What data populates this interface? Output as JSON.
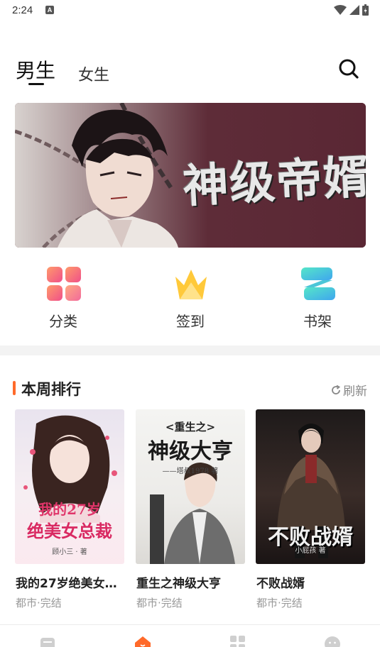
{
  "status": {
    "time": "2:24",
    "notif_glyph": "A"
  },
  "tabs": {
    "male": "男生",
    "female": "女生",
    "active": "male"
  },
  "banner": {
    "title": "神级帝婿"
  },
  "quick": [
    {
      "label": "分类",
      "icon": "category-grid-icon"
    },
    {
      "label": "签到",
      "icon": "crown-icon"
    },
    {
      "label": "书架",
      "icon": "bookshelf-icon"
    }
  ],
  "section": {
    "title": "本周排行",
    "refresh": "刷新",
    "accent": "#ff6a2a"
  },
  "books": [
    {
      "title": "我的27岁绝美女…",
      "meta": "都市·完结",
      "cover_text": "我的27岁绝美女总裁",
      "cover_line1": "我的27岁",
      "cover_line2": "绝美女总裁",
      "cover_author": "顾小三 · 著"
    },
    {
      "title": "重生之神级大亨",
      "meta": "都市·完结",
      "cover_text": "重生之神级大亨",
      "cover_line1": "<重生之>",
      "cover_line2": "神级大亨",
      "cover_author": "——塔叔1978 著"
    },
    {
      "title": "不败战婿",
      "meta": "都市·完结",
      "cover_text": "不败战婿",
      "cover_line1": "不败战婿",
      "cover_author": "小屁孩 著"
    }
  ],
  "bottom_nav": [
    {
      "icon": "bookshelf-nav-icon"
    },
    {
      "icon": "home-nav-icon",
      "active": true
    },
    {
      "icon": "category-nav-icon"
    },
    {
      "icon": "profile-nav-icon"
    }
  ]
}
